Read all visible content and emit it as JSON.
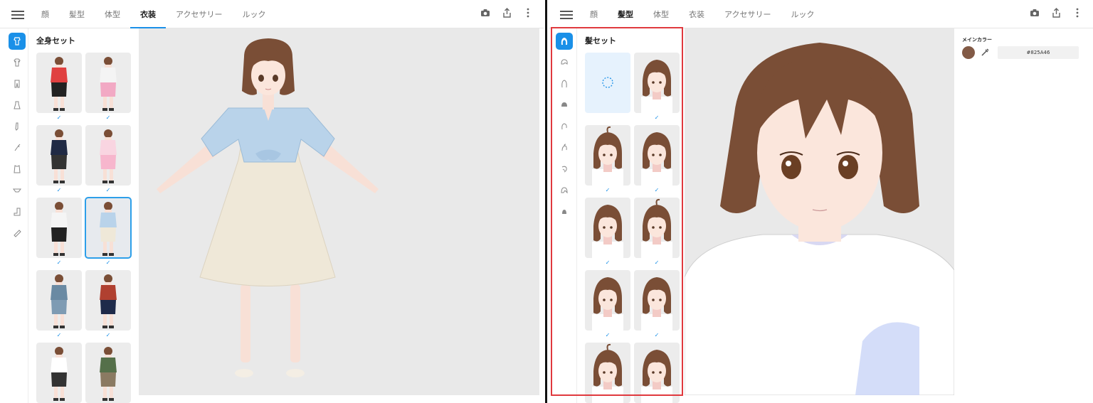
{
  "left_panel": {
    "tabs": [
      {
        "label": "顔",
        "active": false
      },
      {
        "label": "髪型",
        "active": false
      },
      {
        "label": "体型",
        "active": false
      },
      {
        "label": "衣装",
        "active": true
      },
      {
        "label": "アクセサリー",
        "active": false
      },
      {
        "label": "ルック",
        "active": false
      }
    ],
    "list_title": "全身セット",
    "sidebar_icons": [
      "full-set-icon",
      "tops-icon",
      "bottoms-icon",
      "onepiece-icon",
      "socks-icon",
      "gloves-icon",
      "jacket-icon",
      "underwear-icon",
      "shoes-icon",
      "accessory-icon"
    ],
    "outfits": [
      {
        "name": "red-hoodie-outfit",
        "checked": true,
        "selected": false
      },
      {
        "name": "pink-skirt-outfit",
        "checked": true,
        "selected": false
      },
      {
        "name": "navy-uniform-outfit",
        "checked": true,
        "selected": false
      },
      {
        "name": "pink-maid-outfit",
        "checked": true,
        "selected": false
      },
      {
        "name": "sailor-outfit",
        "checked": true,
        "selected": false
      },
      {
        "name": "blue-shirt-dress-outfit",
        "checked": true,
        "selected": true
      },
      {
        "name": "floral-shirt-outfit",
        "checked": true,
        "selected": false
      },
      {
        "name": "red-floral-outfit",
        "checked": true,
        "selected": false
      },
      {
        "name": "white-top-black-pants-outfit",
        "checked": false,
        "selected": false
      },
      {
        "name": "green-jacket-skirt-outfit",
        "checked": false,
        "selected": false
      }
    ]
  },
  "right_panel": {
    "tabs": [
      {
        "label": "顔",
        "active": false
      },
      {
        "label": "髪型",
        "active": true
      },
      {
        "label": "体型",
        "active": false
      },
      {
        "label": "衣装",
        "active": false
      },
      {
        "label": "アクセサリー",
        "active": false
      },
      {
        "label": "ルック",
        "active": false
      }
    ],
    "list_title": "髪セット",
    "sidebar_icons": [
      "hair-set-icon",
      "front-hair-icon",
      "back-hair-icon",
      "top-hair-icon",
      "side-hair-icon",
      "ahoge-icon",
      "ear-hair-icon",
      "extra-hair-icon",
      "hair-accessory-icon"
    ],
    "hairstyles": [
      {
        "name": "no-hair",
        "checked": false
      },
      {
        "name": "short-bob",
        "checked": true
      },
      {
        "name": "bun-ahoge",
        "checked": true
      },
      {
        "name": "long-straight",
        "checked": true
      },
      {
        "name": "side-braid",
        "checked": true
      },
      {
        "name": "medium-wavy",
        "checked": true
      },
      {
        "name": "low-twin",
        "checked": true
      },
      {
        "name": "ahoge-bob",
        "checked": true
      },
      {
        "name": "short-curl",
        "checked": false
      },
      {
        "name": "shaggy-bob",
        "checked": false
      }
    ],
    "inspector": {
      "label": "メインカラー",
      "color_hex": "#825A46",
      "color": "#825A46"
    }
  },
  "colors": {
    "accent": "#1a90e8",
    "highlight_box": "#e0393e",
    "viewport_bg": "#e9e9e9",
    "hair": "#7a4e36"
  }
}
